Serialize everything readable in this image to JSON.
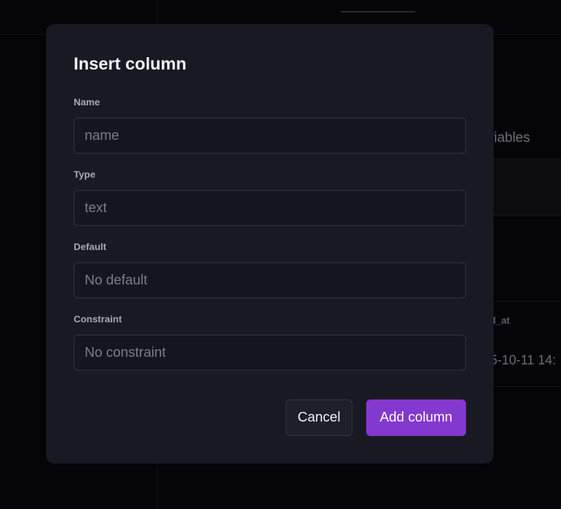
{
  "background": {
    "variables_label": "ariables",
    "column_header": "ed_at",
    "cell_value": "5-10-11 14:"
  },
  "modal": {
    "title": "Insert column",
    "fields": {
      "name": {
        "label": "Name",
        "placeholder": "name",
        "value": ""
      },
      "type": {
        "label": "Type",
        "placeholder": "text",
        "value": ""
      },
      "default": {
        "label": "Default",
        "placeholder": "No default",
        "value": ""
      },
      "constraint": {
        "label": "Constraint",
        "placeholder": "No constraint",
        "value": ""
      }
    },
    "buttons": {
      "cancel": "Cancel",
      "submit": "Add column"
    }
  },
  "colors": {
    "accent": "#8338cf",
    "modal_bg": "#191923",
    "page_bg": "#050507"
  }
}
